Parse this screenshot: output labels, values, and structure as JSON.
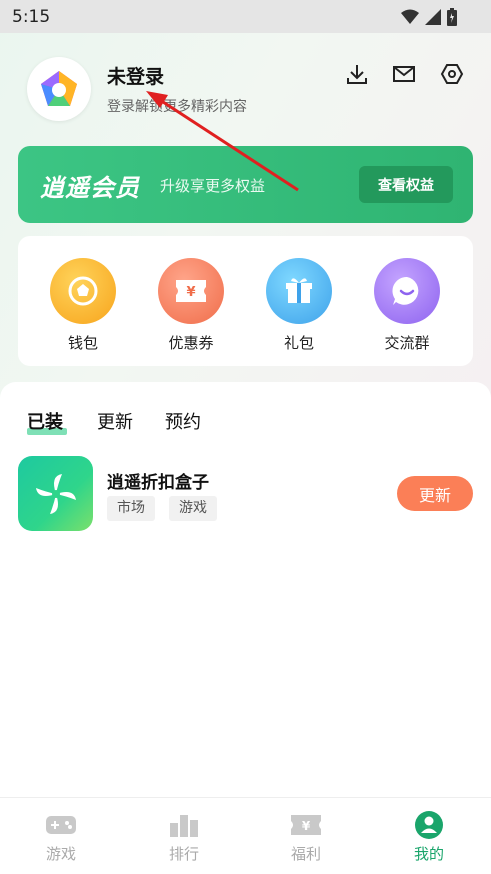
{
  "status_bar": {
    "time": "5:15"
  },
  "profile": {
    "title": "未登录",
    "subtitle": "登录解锁更多精彩内容"
  },
  "header_icons": [
    "download-icon",
    "mail-icon",
    "settings-icon"
  ],
  "vip": {
    "title": "逍遥会员",
    "subtitle": "升级享更多权益",
    "button": "查看权益"
  },
  "quick_actions": [
    {
      "label": "钱包",
      "icon": "wallet-icon"
    },
    {
      "label": "优惠券",
      "icon": "coupon-icon"
    },
    {
      "label": "礼包",
      "icon": "gift-icon"
    },
    {
      "label": "交流群",
      "icon": "chat-icon"
    }
  ],
  "tabs": [
    {
      "label": "已装",
      "active": true
    },
    {
      "label": "更新",
      "active": false
    },
    {
      "label": "预约",
      "active": false
    }
  ],
  "app": {
    "name": "逍遥折扣盒子",
    "tags": [
      "市场",
      "游戏"
    ],
    "button": "更新"
  },
  "bottom_nav": [
    {
      "label": "游戏",
      "icon": "gamepad-icon",
      "active": false
    },
    {
      "label": "排行",
      "icon": "ranking-icon",
      "active": false
    },
    {
      "label": "福利",
      "icon": "ticket-icon",
      "active": false
    },
    {
      "label": "我的",
      "icon": "profile-icon",
      "active": true
    }
  ],
  "colors": {
    "brand_green": "#2fb472",
    "update_orange": "#fb7f57",
    "active_nav": "#1aa56b",
    "arrow_red": "#e02020"
  }
}
